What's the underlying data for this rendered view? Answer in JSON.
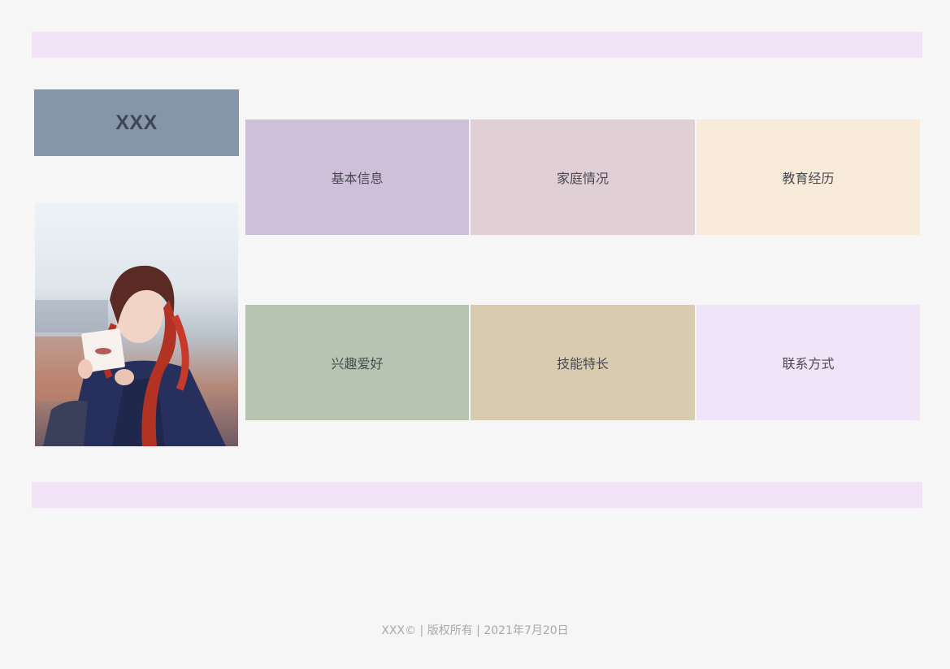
{
  "header": {
    "name": "XXX"
  },
  "colors": {
    "page_bg": "#f6f6f6",
    "bar": "#f3e3f7",
    "name_box": "#8696a9",
    "tile_basic": "#cdc0d8",
    "tile_family": "#e1cfd6",
    "tile_education": "#f8ebda",
    "tile_hobbies": "#b5c5b2",
    "tile_skills": "#d9cbb0",
    "tile_contact": "#f0e5f8"
  },
  "nav": {
    "tiles": [
      {
        "label": "基本信息",
        "color": "#cdc0d8"
      },
      {
        "label": "家庭情况",
        "color": "#e1cfd6"
      },
      {
        "label": "教育经历",
        "color": "#f8ebda"
      },
      {
        "label": "兴趣爱好",
        "color": "#b5c5b2"
      },
      {
        "label": "技能特长",
        "color": "#d9cbb0"
      },
      {
        "label": "联系方式",
        "color": "#f0e5f8"
      }
    ]
  },
  "footer": {
    "text": "XXX© | 版权所有 | 2021年7月20日"
  }
}
